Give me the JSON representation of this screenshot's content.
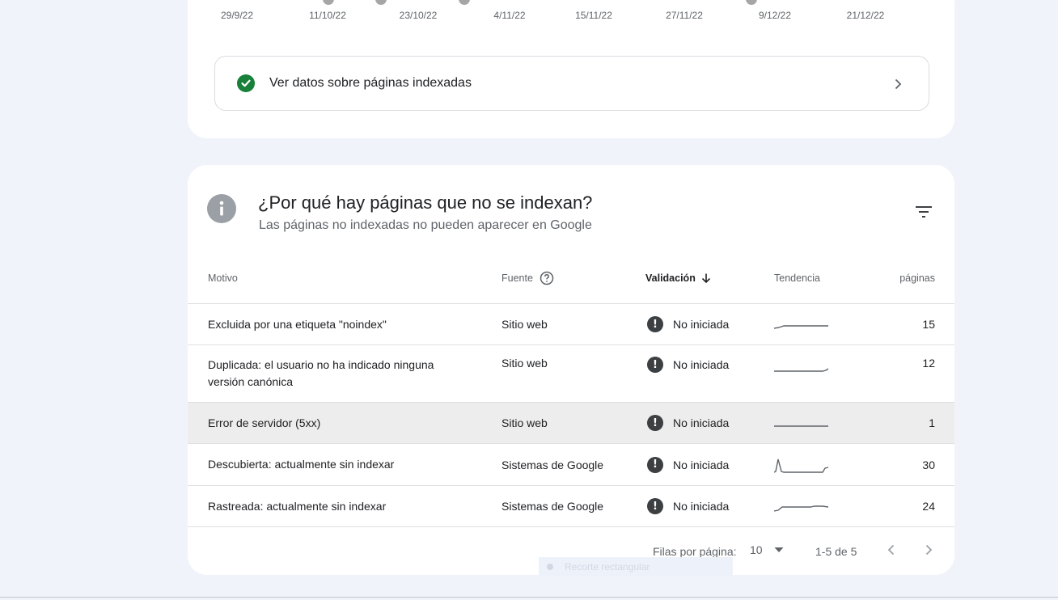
{
  "timeline": {
    "date_labels": [
      "29/9/22",
      "11/10/22",
      "23/10/22",
      "4/11/22",
      "15/11/22",
      "27/11/22",
      "9/12/22",
      "21/12/22"
    ]
  },
  "indexed_link": {
    "label": "Ver datos sobre páginas indexadas",
    "icon": "check-circle-icon",
    "status_color": "#188038"
  },
  "not_indexed": {
    "title": "¿Por qué hay páginas que no se indexan?",
    "subtitle": "Las páginas no indexadas no pueden aparecer en Google",
    "columns": {
      "motivo": "Motivo",
      "fuente": "Fuente",
      "validacion": "Validación",
      "tendencia": "Tendencia",
      "paginas": "páginas"
    },
    "rows": [
      {
        "motivo": "Excluida por una etiqueta \"noindex\"",
        "fuente": "Sitio web",
        "validacion": "No iniciada",
        "paginas": "15"
      },
      {
        "motivo": "Duplicada: el usuario no ha indicado ninguna versión canónica",
        "fuente": "Sitio web",
        "validacion": "No iniciada",
        "paginas": "12"
      },
      {
        "motivo": "Error de servidor (5xx)",
        "fuente": "Sitio web",
        "validacion": "No iniciada",
        "paginas": "1"
      },
      {
        "motivo": "Descubierta: actualmente sin indexar",
        "fuente": "Sistemas de Google",
        "validacion": "No iniciada",
        "paginas": "30"
      },
      {
        "motivo": "Rastreada: actualmente sin indexar",
        "fuente": "Sistemas de Google",
        "validacion": "No iniciada",
        "paginas": "24"
      }
    ],
    "pagination": {
      "rows_per_page_label": "Filas por página:",
      "rows_per_page_value": "10",
      "range": "1-5 de 5"
    }
  },
  "overlay": {
    "label": "Recorte rectangular"
  }
}
